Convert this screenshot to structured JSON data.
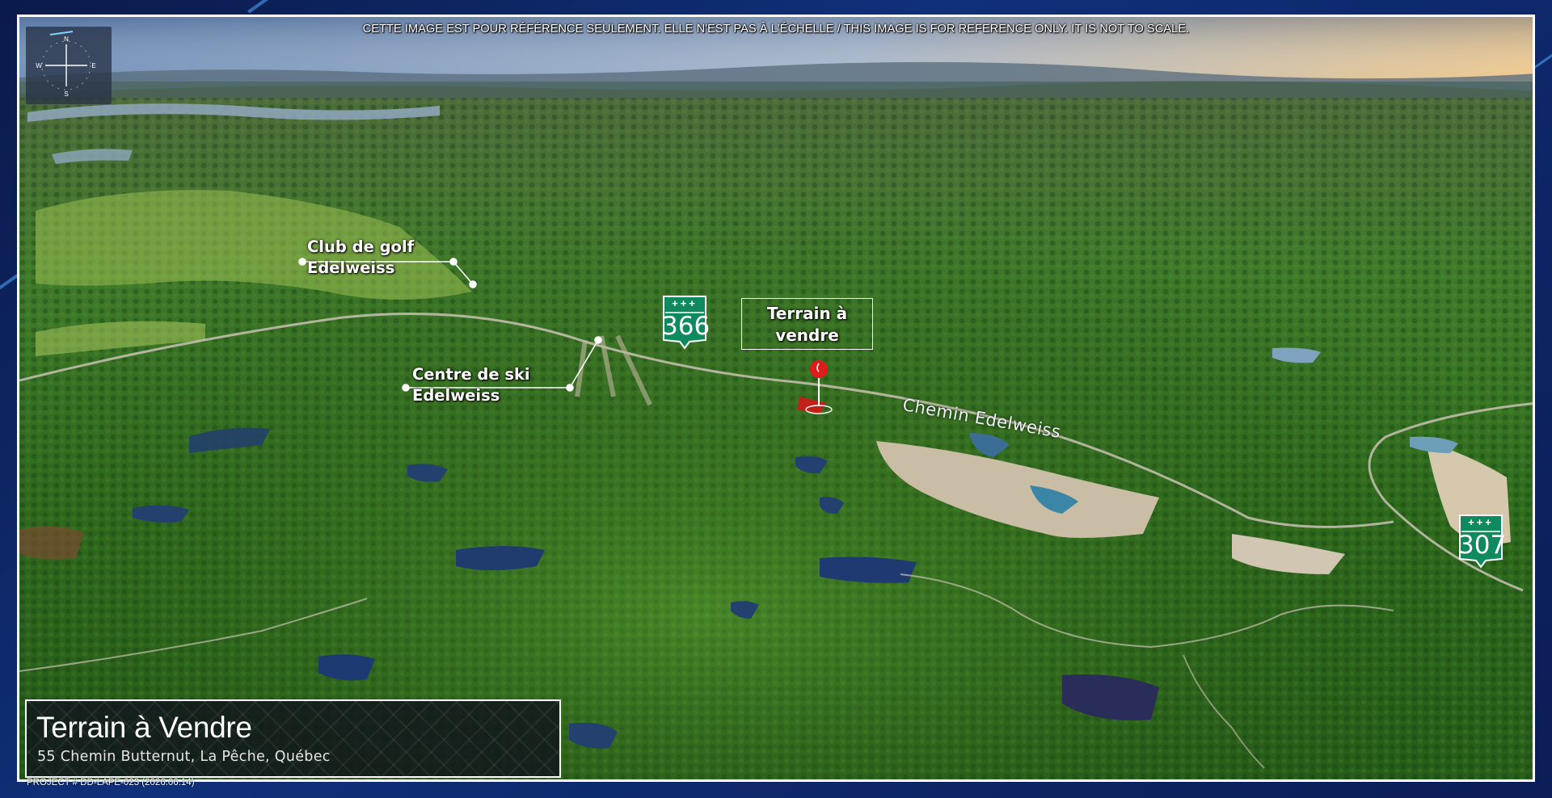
{
  "disclaimer": "CETTE IMAGE EST POUR RÉFÉRENCE SEULEMENT. ELLE N'EST PAS À L'ÉCHELLE / THIS IMAGE IS FOR REFERENCE ONLY. IT IS NOT TO SCALE.",
  "compass": {
    "n": "N",
    "s": "S",
    "e": "E",
    "w": "W"
  },
  "callouts": {
    "golf": {
      "line1": "Club de golf",
      "line2": "Edelweiss"
    },
    "ski": {
      "line1": "Centre de ski",
      "line2": "Edelweiss"
    }
  },
  "sale_marker": {
    "line1": "Terrain à",
    "line2": "vendre"
  },
  "road": {
    "name": "Chemin Edelweiss"
  },
  "highways": [
    {
      "number": "366",
      "crosses": "+++"
    },
    {
      "number": "307",
      "crosses": "+++"
    }
  ],
  "title_block": {
    "title": "Terrain à Vendre",
    "address": "55 Chemin Butternut, La Pêche, Québec"
  },
  "project_ref": "PROJECT # DD-LAPE-023 (2026.06.14)",
  "colors": {
    "shield_green": "#0f8a5f",
    "pin_red": "#e01b1b",
    "frame_blue": "#10307a",
    "forest": "#2f6b1f"
  }
}
